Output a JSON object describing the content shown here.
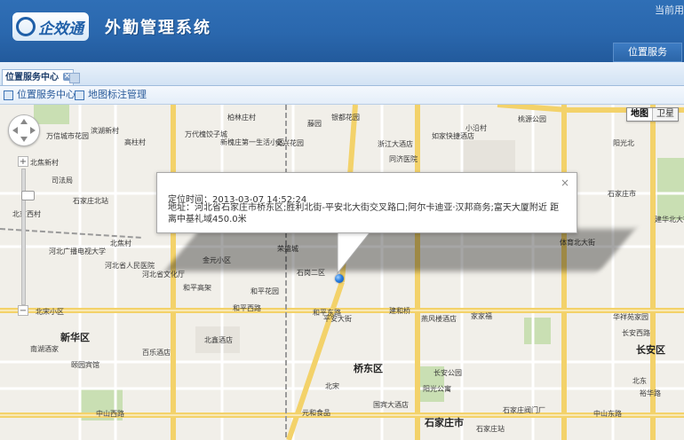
{
  "header": {
    "logo_text": "企效通",
    "system_title": "外勤管理系统",
    "current_user_label": "当前用",
    "nav_button": "位置服务"
  },
  "tabs": [
    {
      "label": "位置服务中心",
      "close": "×"
    }
  ],
  "toolbar": {
    "items": [
      "位置服务中心",
      "地图标注管理"
    ]
  },
  "map": {
    "type_buttons": [
      "地图",
      "卫星"
    ],
    "zoom_in": "+",
    "zoom_out": "−",
    "labels": [
      "柏林庄村",
      "藤园",
      "银都花园",
      "桃源公园",
      "万信城市花园",
      "滨湖新村",
      "高柱村",
      "万代槐饺子城",
      "新槐庄第一生活小区",
      "吴兴花园",
      "浙江大酒店",
      "如家快捷酒店",
      "小沿村",
      "同济医院",
      "石家庄市",
      "北焦新村",
      "石家庄北站",
      "司法局",
      "北京西村",
      "荣盛城",
      "北焦村",
      "河北广播电视大学",
      "金元小区",
      "石岗二区",
      "河北省人民医院",
      "河北省文化厅",
      "和平高架",
      "和平花园",
      "和平西路",
      "平安大街",
      "北宋小区",
      "建和桥",
      "燕风楼酒店",
      "家家福",
      "和平东路",
      "华祥苑家园",
      "新华区",
      "南湖酒家",
      "颐园宾馆",
      "百乐酒店",
      "长安公园",
      "桥东区",
      "石家庄市",
      "中山西路",
      "中山东路",
      "元和食品",
      "北鑫酒店",
      "阳光公寓",
      "国宾大酒店",
      "石家庄站",
      "长安区",
      "北宋",
      "北东",
      "石家庄阀门厂",
      "阳光北",
      "长安西路",
      "体育北大街",
      "建华北大街",
      "裕华路"
    ]
  },
  "info_window": {
    "close": "×",
    "time_line": "定位时间：2013-03-07 14:52:24",
    "address_line": "地址：河北省石家庄市桥东区;胜利北街-平安北大街交叉路口;阿尔卡迪亚·汉邦商务;富天大厦附近 距离中基礼域450.0米"
  },
  "colors": {
    "header_blue": "#2a67ad",
    "map_bg": "#f1efe9",
    "road_major": "#f7d96b",
    "marker": "#2a7ee0"
  }
}
